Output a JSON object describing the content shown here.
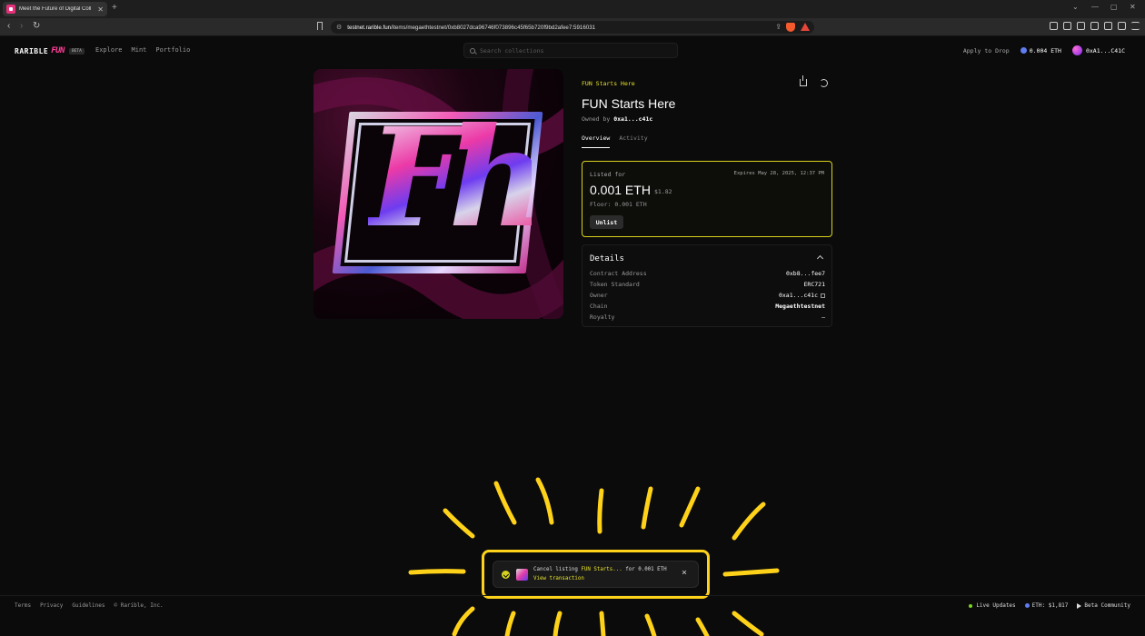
{
  "browser": {
    "tab_title": "Meet the Future of Digital Coll",
    "url_host": "testnet.rarible.fun",
    "url_path": "/items/megaethtestnet/0xb8027dca96746f073896c45f65b720f9bd2afee7:5916031",
    "back_icon": "chevron-left-icon",
    "forward_icon": "chevron-right-icon",
    "reload_icon": "reload-icon"
  },
  "header": {
    "logo_text": "RARIBLE",
    "logo_fun": "FUN",
    "logo_badge": "BETA",
    "nav": [
      "Explore",
      "Mint",
      "Portfolio"
    ],
    "search_placeholder": "Search collections",
    "apply_link": "Apply to Drop",
    "eth_balance": "0.004 ETH",
    "wallet": "0xA1...C41C"
  },
  "item": {
    "collection": "FUN Starts Here",
    "title": "FUN Starts Here",
    "owned_by_label": "Owned by",
    "owner": "0xa1...c41c",
    "tabs": [
      "Overview",
      "Activity"
    ],
    "active_tab": 0
  },
  "listing": {
    "listed_for_label": "Listed for",
    "expires": "Expires May 28, 2025, 12:37 PM",
    "price": "0.001 ETH",
    "price_usd": "$1.82",
    "floor": "Floor: 0.001 ETH",
    "unlist_label": "Unlist"
  },
  "details": {
    "title": "Details",
    "rows": [
      {
        "key": "Contract Address",
        "value": "0xb8...fee7"
      },
      {
        "key": "Token Standard",
        "value": "ERC721"
      },
      {
        "key": "Owner",
        "value": "0xa1...c41c"
      },
      {
        "key": "Chain",
        "value": "Megaethtestnet"
      },
      {
        "key": "Royalty",
        "value": "–"
      }
    ]
  },
  "toast": {
    "prefix": "Cancel listing",
    "item": "FUN Starts...",
    "suffix": "for 0.001 ETH",
    "link": "View transaction"
  },
  "footer": {
    "links": [
      "Terms",
      "Privacy",
      "Guidelines",
      "© Rarible, Inc."
    ],
    "live_updates": "Live Updates",
    "eth_price": "ETH: $1,817",
    "community": "Beta Community"
  },
  "colors": {
    "accent_yellow": "#e8e22a",
    "highlight": "#ffd21a",
    "brand_pink": "#ff3f97"
  }
}
